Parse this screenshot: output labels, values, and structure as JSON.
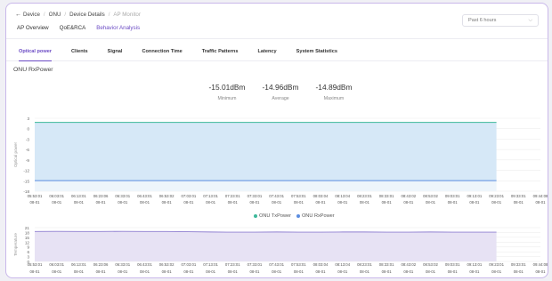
{
  "breadcrumb": {
    "back": "←",
    "items": [
      "Device",
      "ONU",
      "Device Details",
      "AP Monitor"
    ]
  },
  "subtabs": [
    "AP Overview",
    "QoE&RCA",
    "Behavior Analysis"
  ],
  "time_select": {
    "value": "Past 6 hours"
  },
  "tabs": [
    "Optical power",
    "Clients",
    "Signal",
    "Connection Time",
    "Traffic Patterns",
    "Latency",
    "System Statistics"
  ],
  "section_title": "ONU RxPower",
  "stats": [
    {
      "value": "-15.01dBm",
      "label": "Minimum"
    },
    {
      "value": "-14.96dBm",
      "label": "Average"
    },
    {
      "value": "-14.89dBm",
      "label": "Maximum"
    }
  ],
  "legend": [
    {
      "label": "ONU TxPower",
      "color": "#3cb89a"
    },
    {
      "label": "ONU RxPower",
      "color": "#5b8de0"
    }
  ],
  "colors": {
    "accent": "#6b4bc4",
    "tx_line": "#3cb89a",
    "rx_line": "#5b8de0",
    "temp_line": "#8e7ed0"
  },
  "chart_data": [
    {
      "type": "area",
      "ylabel": "Optical power",
      "ylim": [
        -18,
        3
      ],
      "yticks": [
        3,
        0,
        -3,
        -6,
        -9,
        -12,
        -15,
        -18
      ],
      "x_times": [
        "05:53:01",
        "06:03:01",
        "06:13:01",
        "06:23:06",
        "06:33:01",
        "06:43:01",
        "06:53:02",
        "07:03:01",
        "07:13:01",
        "07:23:01",
        "07:33:01",
        "07:43:01",
        "07:53:01",
        "08:03:04",
        "08:13:04",
        "08:23:01",
        "08:33:01",
        "08:43:02",
        "08:53:02",
        "09:03:01",
        "09:13:01",
        "09:23:01",
        "09:33:01",
        "09:44:08"
      ],
      "x_dates": [
        "08-01",
        "08-01",
        "08-01",
        "08-01",
        "08-01",
        "08-01",
        "08-01",
        "08-01",
        "08-01",
        "08-01",
        "08-01",
        "08-01",
        "08-01",
        "08-01",
        "08-01",
        "08-01",
        "08-01",
        "08-01",
        "08-01",
        "08-01",
        "08-01",
        "08-01",
        "08-01",
        "08-01"
      ],
      "data_end_index": 21,
      "series": [
        {
          "name": "ONU TxPower",
          "value": 1.8
        },
        {
          "name": "ONU RxPower",
          "value": -14.96
        }
      ]
    },
    {
      "type": "area",
      "ylabel": "Temperature",
      "ylim": [
        0,
        21
      ],
      "yticks": [
        21,
        18,
        15,
        12,
        9,
        6,
        3,
        0
      ],
      "x_times": [
        "05:53:01",
        "06:03:01",
        "06:13:01",
        "06:23:06",
        "06:33:01",
        "06:43:01",
        "06:53:02",
        "07:03:01",
        "07:13:01",
        "07:23:01",
        "07:33:01",
        "07:43:01",
        "07:53:01",
        "08:03:04",
        "08:13:04",
        "08:23:01",
        "08:33:01",
        "08:43:02",
        "08:53:02",
        "09:03:01",
        "09:13:01",
        "09:23:01",
        "09:33:01",
        "09:44:08"
      ],
      "x_dates": [
        "08-01",
        "08-01",
        "08-01",
        "08-01",
        "08-01",
        "08-01",
        "08-01",
        "08-01",
        "08-01",
        "08-01",
        "08-01",
        "08-01",
        "08-01",
        "08-01",
        "08-01",
        "08-01",
        "08-01",
        "08-01",
        "08-01",
        "08-01",
        "08-01",
        "08-01",
        "08-01",
        "08-01"
      ],
      "data_end_index": 21,
      "series": [
        {
          "name": "",
          "values": [
            18.6,
            18.7,
            18.6,
            18.6,
            18.7,
            18.6,
            18.6,
            18.5,
            18.3,
            18.2,
            18.2,
            18.3,
            18.2,
            18.2,
            18.3,
            18.3,
            18.2,
            18.2,
            18.3,
            18.2,
            18.2,
            18.2
          ]
        }
      ]
    }
  ]
}
